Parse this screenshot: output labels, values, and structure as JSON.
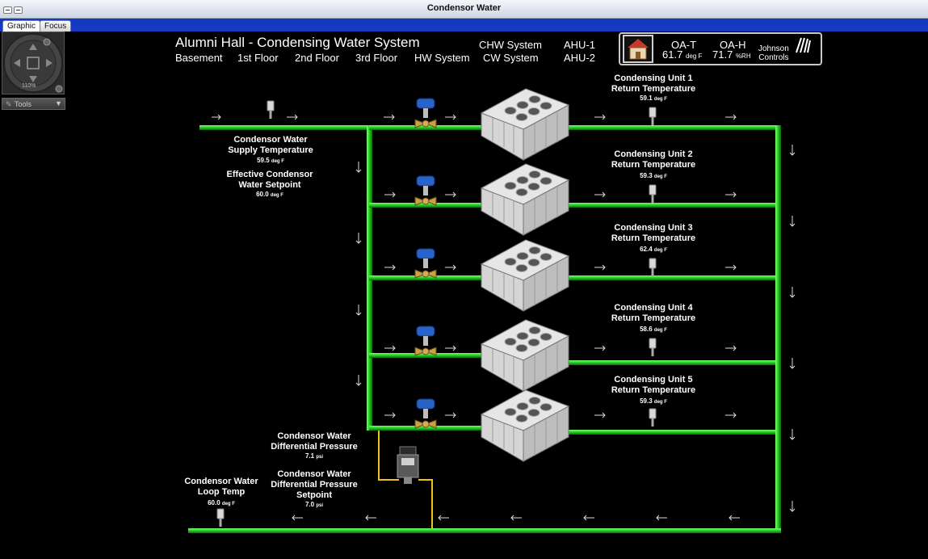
{
  "window": {
    "title": "Condensor Water"
  },
  "tabs": [
    {
      "label": "Graphic"
    },
    {
      "label": "Focus"
    }
  ],
  "nav": {
    "zoom": "110%",
    "tools_label": "Tools"
  },
  "header": {
    "title": "Alumni Hall - Condensing Water System",
    "links": [
      "Basement",
      "1st Floor",
      "2nd Floor",
      "3rd Floor",
      "HW System"
    ],
    "systems": [
      "CHW System",
      "CW System",
      "AHU-1",
      "AHU-2"
    ],
    "oat": {
      "label": "OA-T",
      "value": "61.7",
      "unit": "deg F"
    },
    "oah": {
      "label": "OA-H",
      "value": "71.7",
      "unit": "%RH"
    },
    "brand": [
      "Johnson",
      "Controls"
    ]
  },
  "supply": {
    "label1": "Condensor Water",
    "label2": "Supply Temperature",
    "value": "59.5",
    "unit": "deg F",
    "sp_label1": "Effective Condensor",
    "sp_label2": "Water Setpoint",
    "sp_value": "60.0",
    "sp_unit": "deg F"
  },
  "units": [
    {
      "title": "Condensing Unit 1",
      "subtitle": "Return Temperature",
      "value": "59.1",
      "unit": "deg F"
    },
    {
      "title": "Condensing Unit 2",
      "subtitle": "Return Temperature",
      "value": "59.3",
      "unit": "deg F"
    },
    {
      "title": "Condensing Unit 3",
      "subtitle": "Return Temperature",
      "value": "62.4",
      "unit": "deg F"
    },
    {
      "title": "Condensing Unit 4",
      "subtitle": "Return Temperature",
      "value": "58.6",
      "unit": "deg F"
    },
    {
      "title": "Condensing Unit 5",
      "subtitle": "Return Temperature",
      "value": "59.3",
      "unit": "deg F"
    }
  ],
  "dp": {
    "label1": "Condensor Water",
    "label2": "Differential Pressure",
    "value": "7.1",
    "unit": "psi",
    "sp_label1": "Condensor Water",
    "sp_label2": "Differential Pressure",
    "sp_label3": "Setpoint",
    "sp_value": "7.0",
    "sp_unit": "psi"
  },
  "loop": {
    "label1": "Condensor Water",
    "label2": "Loop Temp",
    "value": "60.0",
    "unit": "deg F"
  },
  "colors": {
    "pipe": "#22cc22",
    "pipe_dark": "#0d6a0d",
    "signal_wire": "#f2c21a",
    "titlebar_text": "#111111",
    "tab_strip": "#1639c0"
  }
}
